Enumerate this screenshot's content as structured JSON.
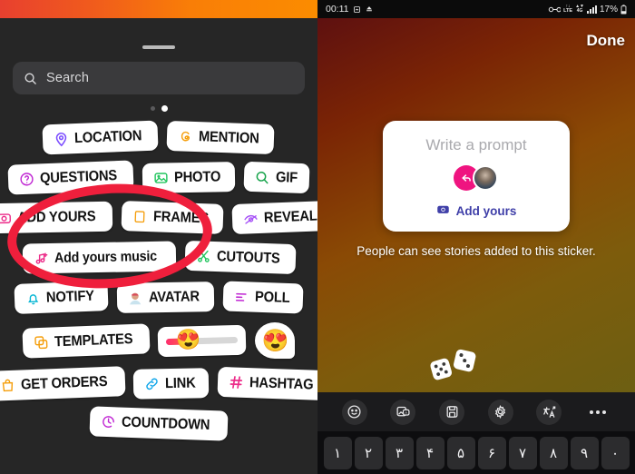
{
  "left_panel": {
    "search": {
      "placeholder": "Search",
      "icon": "search-icon"
    },
    "pagination": {
      "dots": 2,
      "active_index": 1
    },
    "sticker_rows": [
      [
        {
          "label": "LOCATION",
          "icon": "location-pin-icon",
          "icon_color": "#7c4dff",
          "tilt": "tilt-l"
        },
        {
          "label": "MENTION",
          "icon": "threads-at-icon",
          "icon_color": "#f59e0b",
          "tilt": "tilt-r"
        }
      ],
      [
        {
          "label": "QUESTIONS",
          "icon": "question-circle-icon",
          "icon_color": "#c026d3",
          "tilt": "tilt-l"
        },
        {
          "label": "PHOTO",
          "icon": "photo-image-icon",
          "icon_color": "#22c55e",
          "tilt": "tilt-s"
        },
        {
          "label": "GIF",
          "icon": "gif-search-icon",
          "icon_color": "#16a34a",
          "tilt": "tilt-r"
        }
      ],
      [
        {
          "label": "ADD YOURS",
          "icon": "camera-icon",
          "icon_color": "#ec2d8a",
          "tilt": "tilt-s"
        },
        {
          "label": "FRAMES",
          "icon": "frames-icon",
          "icon_color": "#f59e0b",
          "tilt": "tilt-r"
        },
        {
          "label": "REVEAL",
          "icon": "eye-slash-icon",
          "icon_color": "#a855f7",
          "tilt": "tilt-l"
        }
      ],
      [
        {
          "label": "Add yours music",
          "icon": "music-note-plus-icon",
          "icon_color": "#ec2d8a",
          "tilt": "tilt-s",
          "mixedcase": true
        },
        {
          "label": "CUTOUTS",
          "icon": "scissors-icon",
          "icon_color": "#22c55e",
          "tilt": "tilt-r"
        }
      ],
      [
        {
          "label": "NOTIFY",
          "icon": "bell-icon",
          "icon_color": "#06b6d4",
          "tilt": "tilt-l"
        },
        {
          "label": "AVATAR",
          "icon": "avatar-face-icon",
          "icon_color": "#d97757",
          "tilt": "tilt-s"
        },
        {
          "label": "POLL",
          "icon": "poll-bars-icon",
          "icon_color": "#c026d3",
          "tilt": "tilt-r"
        }
      ],
      [
        {
          "label": "TEMPLATES",
          "icon": "templates-icon",
          "icon_color": "#f59e0b",
          "tilt": "tilt-l"
        }
      ],
      [
        {
          "label": "GET ORDERS",
          "icon": "shopping-bag-icon",
          "icon_color": "#f59e0b",
          "tilt": "tilt-l"
        },
        {
          "label": "LINK",
          "icon": "link-chain-icon",
          "icon_color": "#0ea5e9",
          "tilt": "tilt-s"
        },
        {
          "label": "HASHTAG",
          "icon": "hashtag-icon",
          "icon_color": "#ec2d8a",
          "tilt": "tilt-r",
          "prefix_hash": true
        }
      ],
      [
        {
          "label": "COUNTDOWN",
          "icon": "countdown-clock-icon",
          "icon_color": "#c026d3",
          "tilt": "tilt-r"
        }
      ]
    ],
    "emoji_slider": {
      "emoji": "😍",
      "fill_percent": 20,
      "name": "emoji-slider-sticker"
    },
    "emoji_reaction": {
      "emoji": "😍",
      "name": "emoji-reaction-sticker"
    },
    "annotation": {
      "type": "red-ellipse",
      "color": "#ef1f3c",
      "targets": "ADD YOURS"
    }
  },
  "right_panel": {
    "status_bar": {
      "time": "00:11",
      "battery": "17%",
      "network": "LTE",
      "icons": [
        "screenshot-icon",
        "upload-cloud-icon",
        "eye-care-icon",
        "lte-icon",
        "vpn-icon",
        "signal-bars-icon",
        "battery-icon"
      ]
    },
    "done_label": "Done",
    "prompt_card": {
      "title": "Write a prompt",
      "add_yours_label": "Add yours",
      "camera_icon": "camera-icon",
      "reply_icon": "reply-arrow-icon",
      "avatar_icon": "user-avatar"
    },
    "caption": "People can see stories added to this sticker.",
    "dice_icon": "dice-pair-icon",
    "toolbar": [
      {
        "name": "emoji-smiley-icon",
        "glyph": "smiley"
      },
      {
        "name": "sticker-image-icon",
        "glyph": "sticker"
      },
      {
        "name": "save-clipboard-icon",
        "glyph": "save"
      },
      {
        "name": "gear-settings-icon",
        "glyph": "gear"
      },
      {
        "name": "translate-swap-icon",
        "glyph": "translate"
      },
      {
        "name": "more-options-icon",
        "glyph": "dots"
      }
    ],
    "keyboard_keys": [
      "۱",
      "۲",
      "۳",
      "۴",
      "۵",
      "۶",
      "۷",
      "۸",
      "۹",
      "۰"
    ]
  }
}
